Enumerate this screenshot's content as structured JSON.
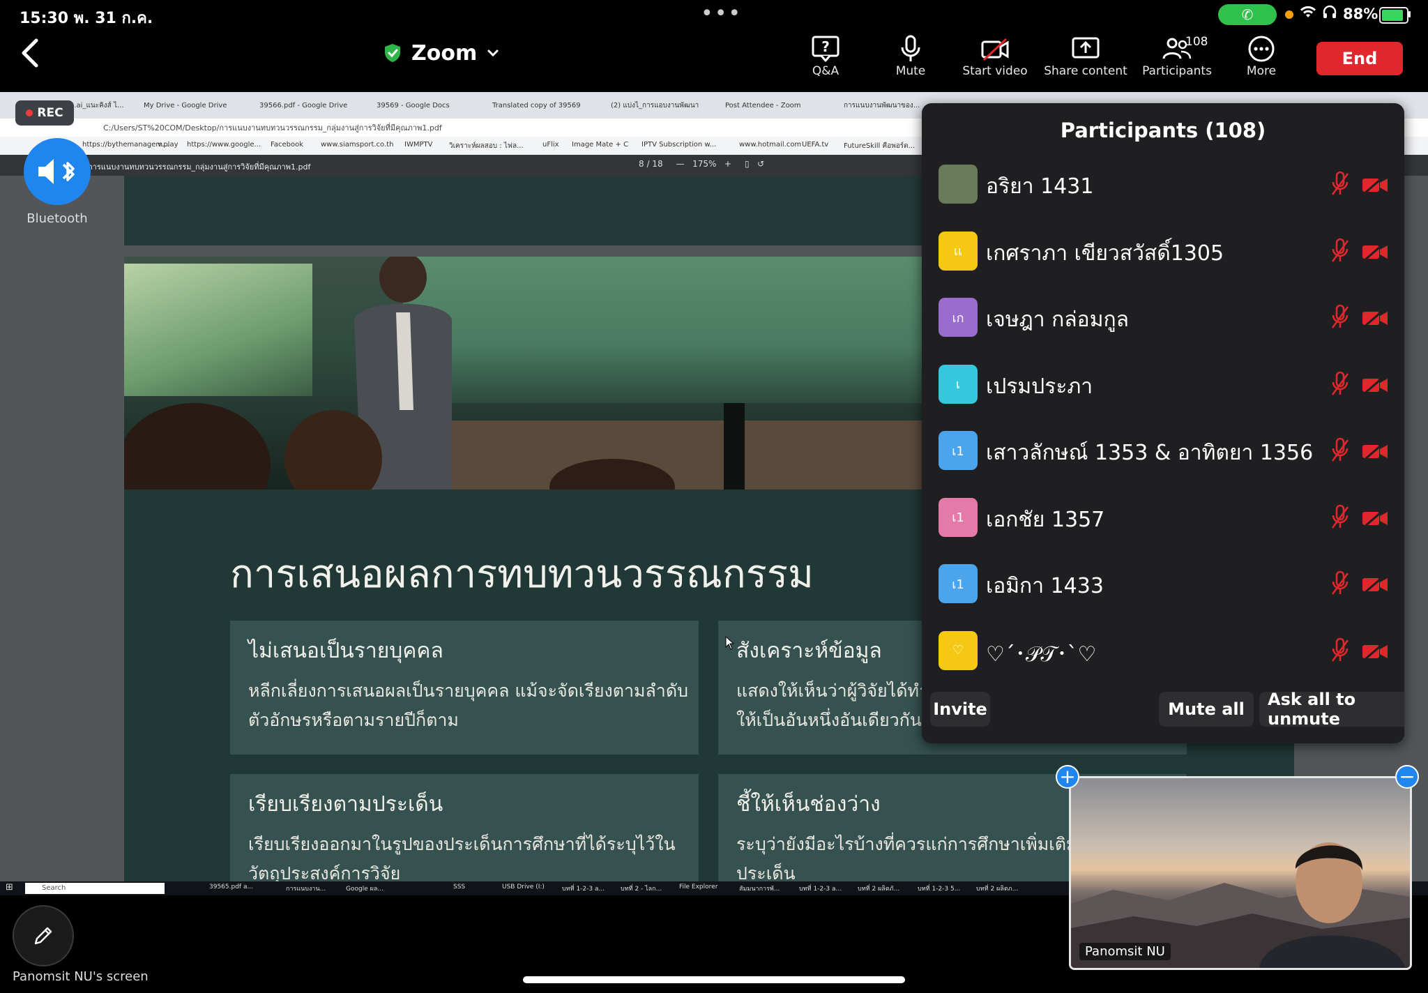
{
  "status_bar": {
    "time_date": "15:30  พ. 31 ก.ค.",
    "dots": "•••",
    "battery": "88%",
    "battery_level": 0.88,
    "call_color": "#2fc14b"
  },
  "toolbar": {
    "title": "Zoom",
    "qa_label": "Q&A",
    "mute_label": "Mute",
    "start_video_label": "Start video",
    "share_label": "Share content",
    "participants_label": "Participants",
    "participants_count": "108",
    "more_label": "More",
    "end_label": "End",
    "end_color": "#e0272c"
  },
  "rec_label": "REC",
  "bluetooth_label": "Bluetooth",
  "shared_screen": {
    "browser_tabs": [
      "...ai_แนะคิงส์ ไ...",
      "My Drive - Google Drive",
      "39566.pdf - Google Drive",
      "39569 - Google Docs",
      "Translated copy of 39569",
      "(2) แบ่งไ_การแอบงานพัฒนา",
      "Post Attendee - Zoom",
      "การแนบงานพัฒนาของ..."
    ],
    "address": "C:/Users/ST%20COM/Desktop/การแนบงานทบทวนวรรณกรรม_กลุ่มงานสู่การวิจัยที่มีคุณภาพ1.pdf",
    "bookmarks": [
      "https://bythemanagem...",
      "v.play",
      "https://www.google...",
      "Facebook",
      "www.siamsport.co.th",
      "IWMPTV",
      "วิเคราะห์ผลสอบ : ไฟล...",
      "uFlix",
      "Image Mate + C",
      "IPTV Subscription w...",
      "www.hotmail.com",
      "UEFA.tv",
      "FutureSkill คือพอร์ต..."
    ],
    "pdf_file_name": "การแนบงานทบทวนวรรณกรรม_กลุ่มงานสู่การวิจัยที่มีคุณภาพ1.pdf",
    "pdf_page": "8 / 18",
    "pdf_zoom": "175%",
    "slide": {
      "title": "การเสนอผลการทบทวนวรรณกรรม",
      "cards": [
        {
          "heading": "ไม่เสนอเป็นรายบุคคล",
          "body": "หลีกเลี่ยงการเสนอผลเป็นรายบุคคล แม้จะจัดเรียงตามลำดับ\nตัวอักษรหรือตามรายปีก็ตาม"
        },
        {
          "heading": "สังเคราะห์ข้อมูล",
          "body": "แสดงให้เห็นว่าผู้วิจัยได้ทำ\nให้เป็นอันหนึ่งอันเดียวกัน"
        },
        {
          "heading": "เรียบเรียงตามประเด็น",
          "body": "เรียบเรียงออกมาในรูปของประเด็นการศึกษาที่ได้ระบุไว้ใน\nวัตถุประสงค์การวิจัย"
        },
        {
          "heading": "ชี้ให้เห็นช่องว่าง",
          "body": "ระบุว่ายังมีอะไรบ้างที่ควรแก่การศึกษาเพิ่มเติม\nประเด็น"
        }
      ]
    },
    "taskbar": {
      "search_placeholder": "Search",
      "items": [
        "39565.pdf a...",
        "การแนบงาน...",
        "Google ผล...",
        "SSS",
        "USB Drive (I:)",
        "บทที่ 1-2-3 a...",
        "บทที่ 2 - ไลก...",
        "File Explorer",
        "สัมมนาการพั...",
        "บทที่ 1-2-3 a...",
        "บทที่ 2 ผลิตภั...",
        "บทที่ 1-2-3 5...",
        "บทที่ 2 ผลิตภ..."
      ]
    }
  },
  "participants_panel": {
    "title": "Participants (108)",
    "participants": [
      {
        "name": "อริยา 1431",
        "avatar_text": "",
        "avatar_color": "#6a7b5a"
      },
      {
        "name": "เกศราภา เขียวสวัสดิ์1305",
        "avatar_text": "เเ",
        "avatar_color": "#f5c814"
      },
      {
        "name": "เจษฎา กล่อมกูล",
        "avatar_text": "เก",
        "avatar_color": "#9a6ccd"
      },
      {
        "name": "เปรมประภา",
        "avatar_text": "เ",
        "avatar_color": "#35c7db"
      },
      {
        "name": "เสาวลักษณ์ 1353 & อาทิตยา 1356",
        "avatar_text": "เ1",
        "avatar_color": "#4aa5ec"
      },
      {
        "name": "เอกชัย 1357",
        "avatar_text": "เ1",
        "avatar_color": "#e37aa8"
      },
      {
        "name": "เอมิกา 1433",
        "avatar_text": "เ1",
        "avatar_color": "#4aa5ec"
      },
      {
        "name": "♡´･𝒫𝒯･`♡",
        "avatar_text": "♡",
        "avatar_color": "#f5c814"
      }
    ],
    "invite_label": "Invite",
    "mute_all_label": "Mute all",
    "ask_unmute_label": "Ask all to unmute",
    "muted_color": "#e0272c"
  },
  "self_view": {
    "name": "Panomsit NU"
  },
  "screen_owner_label": "Panomsit NU's screen"
}
